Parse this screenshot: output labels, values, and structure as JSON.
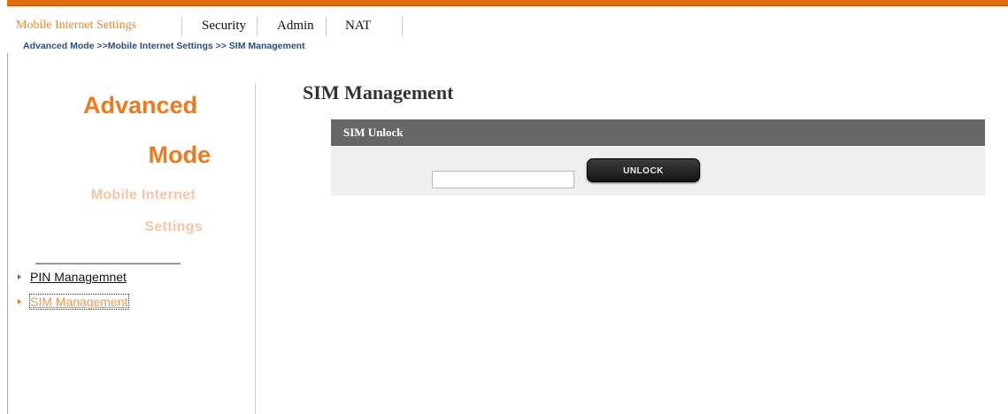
{
  "topnav": {
    "tabs": [
      {
        "label": "Mobile Internet Settings",
        "active": true
      },
      {
        "label": "Security",
        "active": false
      },
      {
        "label": "Admin",
        "active": false
      },
      {
        "label": "NAT",
        "active": false
      }
    ]
  },
  "breadcrumb": "Advanced Mode >>Mobile Internet Settings >> SIM Management",
  "sidebar": {
    "heading_line1": "Advanced",
    "heading_line2": "Mode",
    "subheading_line1": "Mobile Internet",
    "subheading_line2": "Settings",
    "items": [
      {
        "label": "PIN Managemnet",
        "active": false
      },
      {
        "label": "SIM Management",
        "active": true
      }
    ]
  },
  "main": {
    "title": "SIM Management",
    "panel": {
      "header": "SIM Unlock",
      "input_value": "",
      "button_label": "UNLOCK"
    }
  },
  "colors": {
    "accent": "#e46b12",
    "heading": "#f07a1a",
    "subheading": "#f3c6a4",
    "panel_header": "#676767",
    "panel_body": "#efefef"
  }
}
